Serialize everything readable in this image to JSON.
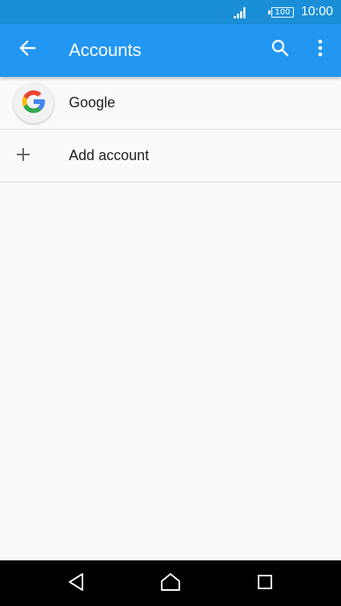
{
  "status_bar": {
    "battery": "100",
    "time": "10:00"
  },
  "app_bar": {
    "title": "Accounts",
    "back_icon": "arrow-back-icon",
    "search_icon": "search-icon",
    "more_icon": "more-vert-icon"
  },
  "accounts": [
    {
      "label": "Google",
      "icon": "google-icon"
    },
    {
      "label": "Add account",
      "icon": "plus-icon"
    }
  ],
  "nav_bar": {
    "back_icon": "nav-back-icon",
    "home_icon": "nav-home-icon",
    "recents_icon": "nav-recents-icon"
  },
  "colors": {
    "status_bar": "#1a8fd8",
    "app_bar": "#2196f3",
    "background": "#fafafa",
    "nav_bar": "#000000",
    "google_blue": "#4285f4",
    "google_red": "#ea4335",
    "google_yellow": "#fbbc05",
    "google_green": "#34a853"
  }
}
